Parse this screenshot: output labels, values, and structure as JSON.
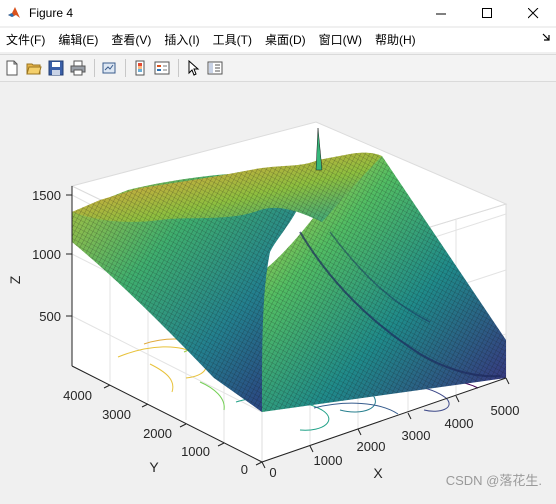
{
  "window": {
    "title": "Figure 4",
    "controls": {
      "minimize": "—",
      "maximize": "☐",
      "close": "✕"
    }
  },
  "menubar": {
    "items": [
      {
        "label": "文件(F)"
      },
      {
        "label": "编辑(E)"
      },
      {
        "label": "查看(V)"
      },
      {
        "label": "插入(I)"
      },
      {
        "label": "工具(T)"
      },
      {
        "label": "桌面(D)"
      },
      {
        "label": "窗口(W)"
      },
      {
        "label": "帮助(H)"
      }
    ],
    "overflow_icon": "dock-arrow-icon"
  },
  "toolbar": {
    "buttons": [
      "new-figure-icon",
      "open-file-icon",
      "save-icon",
      "print-icon",
      "link-plot-icon",
      "colorbar-icon",
      "legend-icon",
      "select-pointer-icon",
      "property-inspector-icon"
    ]
  },
  "plot": {
    "zlabel": "Z",
    "ylabel": "Y",
    "xlabel": "X",
    "z_ticks": [
      "500",
      "1000",
      "1500"
    ],
    "y_ticks": [
      "0",
      "1000",
      "2000",
      "3000",
      "4000"
    ],
    "x_ticks": [
      "0",
      "1000",
      "2000",
      "3000",
      "4000",
      "5000"
    ]
  },
  "chart_data": {
    "type": "surface",
    "subtype": "surfc (3-D surface with contour projection)",
    "colormap": "viridis",
    "x_range": [
      0,
      5000
    ],
    "y_range": [
      0,
      4000
    ],
    "z_range": [
      0,
      1600
    ],
    "xlabel": "X",
    "ylabel": "Y",
    "zlabel": "Z",
    "x_ticks": [
      0,
      1000,
      2000,
      3000,
      4000,
      5000
    ],
    "y_ticks": [
      0,
      1000,
      2000,
      3000,
      4000
    ],
    "z_ticks": [
      500,
      1000,
      1500
    ],
    "grid": true
  },
  "watermark": "CSDN @落花生."
}
